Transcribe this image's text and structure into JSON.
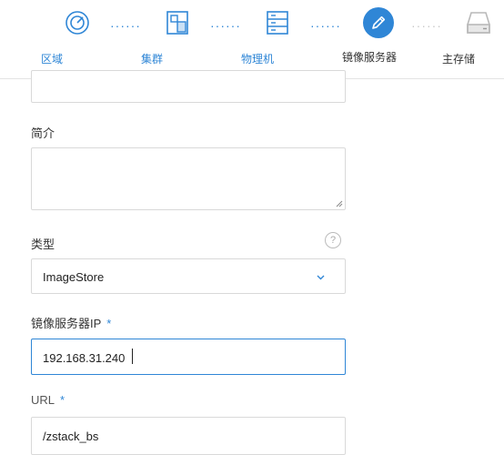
{
  "steps": [
    {
      "label": "区域",
      "icon": "target-icon",
      "state": "done"
    },
    {
      "label": "集群",
      "icon": "cluster-icon",
      "state": "done"
    },
    {
      "label": "物理机",
      "icon": "server-icon",
      "state": "done"
    },
    {
      "label": "镜像服务器",
      "icon": "pencil-icon",
      "state": "active"
    },
    {
      "label": "主存储",
      "icon": "storage-icon",
      "state": "pending"
    }
  ],
  "form": {
    "description_label": "简介",
    "description_value": "",
    "type_label": "类型",
    "type_value": "ImageStore",
    "ip_label": "镜像服务器IP",
    "ip_value": "192.168.31.240",
    "url_label": "URL",
    "url_value": "/zstack_bs",
    "required_mark": "*",
    "help_glyph": "?"
  },
  "colors": {
    "accent": "#2f86d6",
    "border": "#d9d9d9",
    "focus_border": "#2f86d6"
  }
}
